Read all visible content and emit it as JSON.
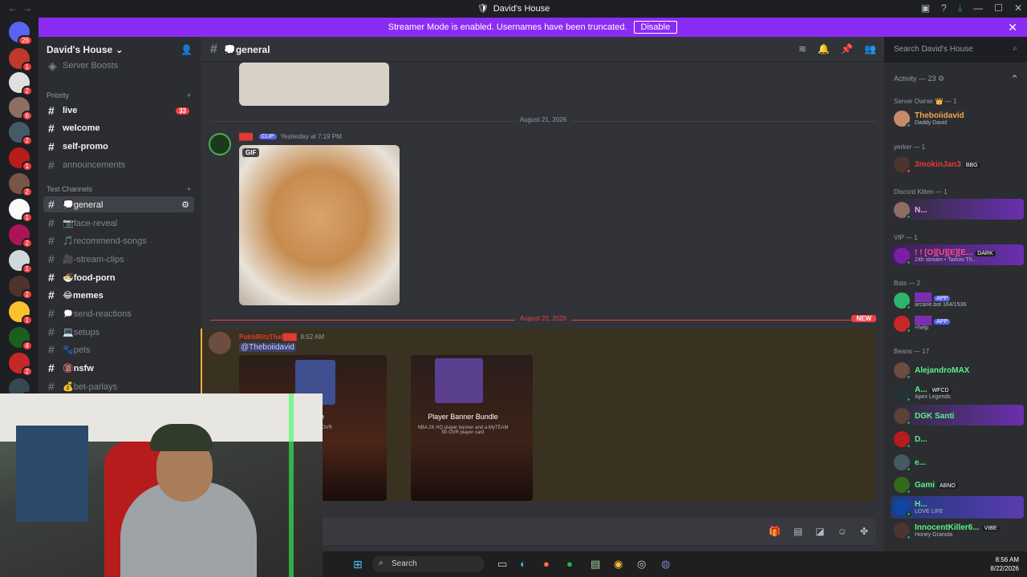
{
  "window": {
    "title": "David's House"
  },
  "banner": {
    "text": "Streamer Mode is enabled. Usernames have been truncated.",
    "button": "Disable"
  },
  "server": {
    "name": "David's House",
    "boosts_label": "Server Boosts"
  },
  "guild_badges": [
    "26",
    "1",
    "2",
    "6",
    "2",
    "1",
    "2",
    "1",
    "2",
    "1",
    "2",
    "1",
    "2",
    "4",
    "2",
    "2"
  ],
  "categories": {
    "priority": "Priority",
    "text": "Text Channels"
  },
  "channels": [
    {
      "label": "live",
      "count": "33"
    },
    {
      "label": "welcome"
    },
    {
      "label": "self-promo"
    },
    {
      "label": "announcements"
    },
    {
      "label": "💭general"
    },
    {
      "label": "📷face-reveal"
    },
    {
      "label": "🎵recommend-songs"
    },
    {
      "label": "🎥-stream-clips"
    },
    {
      "label": "🍜food-porn"
    },
    {
      "label": "😂memes"
    },
    {
      "label": "🗯️send-reactions"
    },
    {
      "label": "💻setups"
    },
    {
      "label": "🐾pets"
    },
    {
      "label": "🔞nsfw"
    },
    {
      "label": "💰bet-parlays"
    }
  ],
  "header": {
    "channel": "💭general",
    "search_placeholder": "Search David's House"
  },
  "messages": {
    "date1": "August 21, 2026",
    "m1_author": "███",
    "m1_tag": "CLIP",
    "m1_time": "Yesterday at 7:19 PM",
    "gif_label": "GIF",
    "date2": "August 22, 2026",
    "new_label": "NEW",
    "m2_author": "PutridRitzThat███",
    "m2_time": "8:52 AM",
    "m2_mention": "@Theboiidavid",
    "card1_title": "Bundle",
    "card1_desc": "MyTEAM 92 OVR",
    "card2_title": "Player Banner Bundle",
    "card2_desc": "NBA 2K HQ player banner and a MyTEAM 90 OVR player card"
  },
  "members": {
    "activity": "Activity — 23",
    "groups": [
      {
        "name": "Server Owner 👑 — 1",
        "items": [
          {
            "name": "Theboiidavid",
            "sub": "Daddy David",
            "color": "#f0a84b"
          }
        ]
      },
      {
        "name": "yerker — 1",
        "items": [
          {
            "name": "3mokinJan3",
            "sub": "",
            "tag": "BBG",
            "color": "#e53935"
          }
        ]
      },
      {
        "name": "Discord Kitten — 1",
        "items": [
          {
            "name": "N...",
            "sub": "",
            "color": "#f2a7ff"
          }
        ]
      },
      {
        "name": "VIP — 1",
        "items": [
          {
            "name": "! ! [O][U][E][E...",
            "sub": "24h stream • Tarkov Th...",
            "tag": "DARK",
            "color": "#ff4f8b"
          }
        ]
      },
      {
        "name": "Bots — 2",
        "items": [
          {
            "name": "███",
            "sub": "arcane.bot 164/1536",
            "tag": "APP",
            "color": "#2fb36b"
          },
          {
            "name": "███",
            "sub": "+help",
            "tag": "APP",
            "color": "#5865f2"
          }
        ]
      },
      {
        "name": "Beans — 17",
        "items": [
          {
            "name": "AlejandroMAX",
            "sub": "",
            "color": "#57f287"
          },
          {
            "name": "A...",
            "sub": "Apex Legends",
            "tag": "WFCD",
            "color": "#57f287"
          },
          {
            "name": "DGK Santi",
            "sub": "",
            "color": "#57f287"
          },
          {
            "name": "D...",
            "sub": "",
            "color": "#57f287"
          },
          {
            "name": "e...",
            "sub": "",
            "color": "#57f287"
          },
          {
            "name": "Gami",
            "sub": "",
            "tag": "ABNO",
            "color": "#57f287"
          },
          {
            "name": "H...",
            "sub": "LOVE LIFE",
            "color": "#57f287"
          },
          {
            "name": "InnocentKiller6...",
            "sub": "Honey Granola",
            "tag": "VIBE",
            "color": "#57f287"
          }
        ]
      }
    ]
  },
  "taskbar": {
    "search": "Search",
    "time": "8:56 AM",
    "date": "8/22/2026"
  }
}
